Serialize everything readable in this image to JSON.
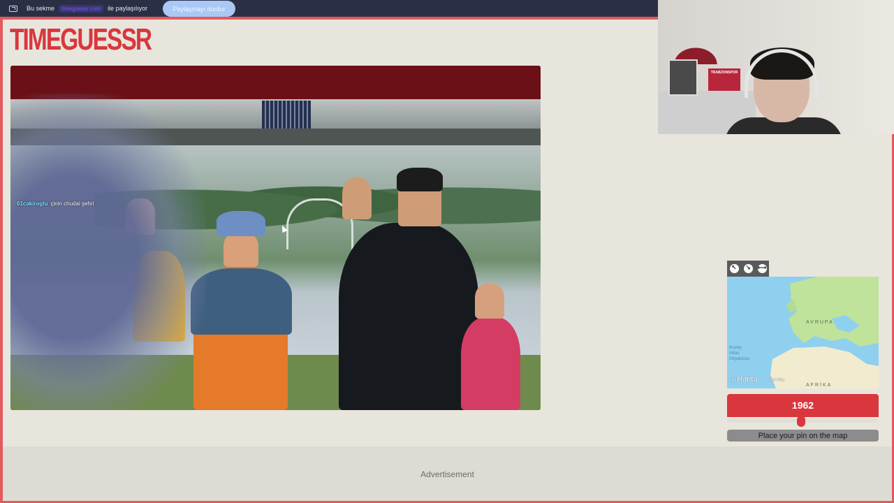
{
  "share_bar": {
    "icon": "screen-share-icon",
    "prefix": "Bu sekme",
    "host": "timeguessr.com",
    "suffix": "ile paylaşılıyor",
    "stop_label": "Paylaşmayı durdur"
  },
  "logo": {
    "text": "TIMEGUESSR",
    "color": "#d9373d"
  },
  "chat": {
    "user": "61cakiroglu",
    "message": "çinin chudai şehri"
  },
  "webcam": {
    "sign_text": "TRABZONSPOR"
  },
  "map": {
    "tools": [
      "expand-icon",
      "shrink-icon",
      "collapse-icon"
    ],
    "labels": {
      "europe": "AVRUPA",
      "africa": "AFRİKA",
      "ocean": "Kuzey Atlas Okyanusu"
    },
    "brand": "Harita",
    "legal": "Yasal Bilgi"
  },
  "guess": {
    "year": "1962",
    "slider_fraction": 0.49,
    "button_label": "Place your pin on the map"
  },
  "ad": {
    "label": "Advertisement"
  },
  "colors": {
    "accent": "#d9373d",
    "frame": "#e35a5e",
    "background": "#e8e6dc"
  }
}
